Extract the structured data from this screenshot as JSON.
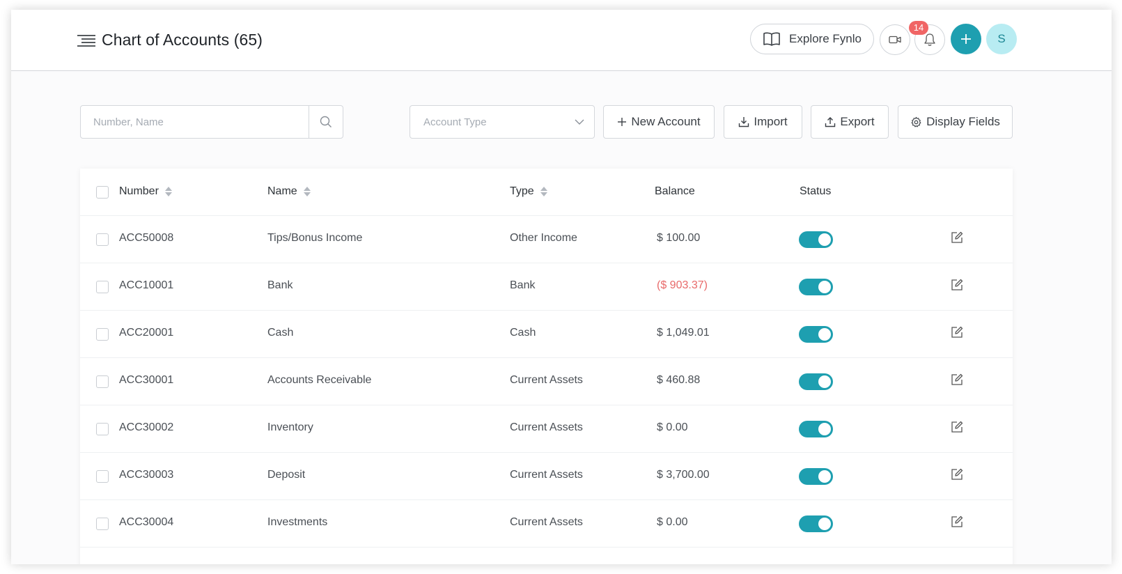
{
  "header": {
    "title": "Chart of Accounts (65)",
    "explore_label": "Explore Fynlo",
    "notification_count": "14",
    "avatar_initial": "S"
  },
  "toolbar": {
    "search_placeholder": "Number, Name",
    "account_type_placeholder": "Account Type",
    "new_account_label": "New Account",
    "import_label": "Import",
    "export_label": "Export",
    "display_fields_label": "Display Fields"
  },
  "table": {
    "columns": {
      "number": "Number",
      "name": "Name",
      "type": "Type",
      "balance": "Balance",
      "status": "Status"
    },
    "rows": [
      {
        "number": "ACC50008",
        "name": "Tips/Bonus Income",
        "type": "Other Income",
        "balance": "$ 100.00",
        "active": true
      },
      {
        "number": "ACC10001",
        "name": "Bank",
        "type": "Bank",
        "balance": "($ 903.37)",
        "active": true
      },
      {
        "number": "ACC20001",
        "name": "Cash",
        "type": "Cash",
        "balance": "$ 1,049.01",
        "active": true
      },
      {
        "number": "ACC30001",
        "name": "Accounts Receivable",
        "type": "Current Assets",
        "balance": "$ 460.88",
        "active": true
      },
      {
        "number": "ACC30002",
        "name": "Inventory",
        "type": "Current Assets",
        "balance": "$ 0.00",
        "active": true
      },
      {
        "number": "ACC30003",
        "name": "Deposit",
        "type": "Current Assets",
        "balance": "$ 3,700.00",
        "active": true
      },
      {
        "number": "ACC30004",
        "name": "Investments",
        "type": "Current Assets",
        "balance": "$ 0.00",
        "active": true
      }
    ]
  },
  "colors": {
    "accent": "#1e9fb0",
    "badge": "#f06565",
    "negative": "#e86a6a",
    "avatar_bg": "#b8ecf2"
  }
}
